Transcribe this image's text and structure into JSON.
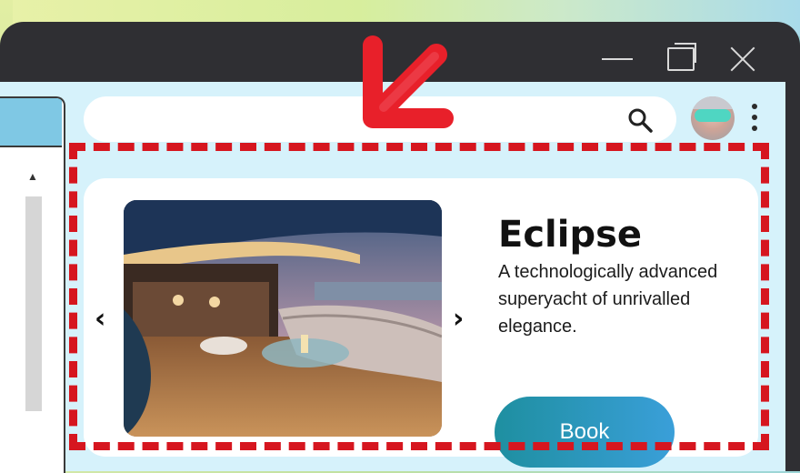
{
  "window": {
    "controls": {
      "minimize_icon": "minimize-icon",
      "maximize_icon": "maximize-icon",
      "close_icon": "close-icon"
    }
  },
  "sidebar": {
    "scroll_up_glyph": "▲"
  },
  "search": {
    "placeholder": "",
    "icon": "search-icon"
  },
  "profile": {
    "avatar_icon": "avatar",
    "menu_icon": "more-vert-icon"
  },
  "card": {
    "prev_glyph": "‹",
    "next_glyph": "›",
    "image_alt": "yacht-deck-photo",
    "title": "Eclipse",
    "description": "A technologically advanced superyacht of unrivalled elegance.",
    "cta_label": "Book"
  },
  "annotations": {
    "highlight_color": "#d6161f",
    "arrow_color": "#e8202a"
  },
  "colors": {
    "window_chrome": "#2f2f33",
    "client_bg": "#d6f2fb",
    "button_gradient_start": "#1e8fa0",
    "button_gradient_end": "#3a9fd9"
  }
}
